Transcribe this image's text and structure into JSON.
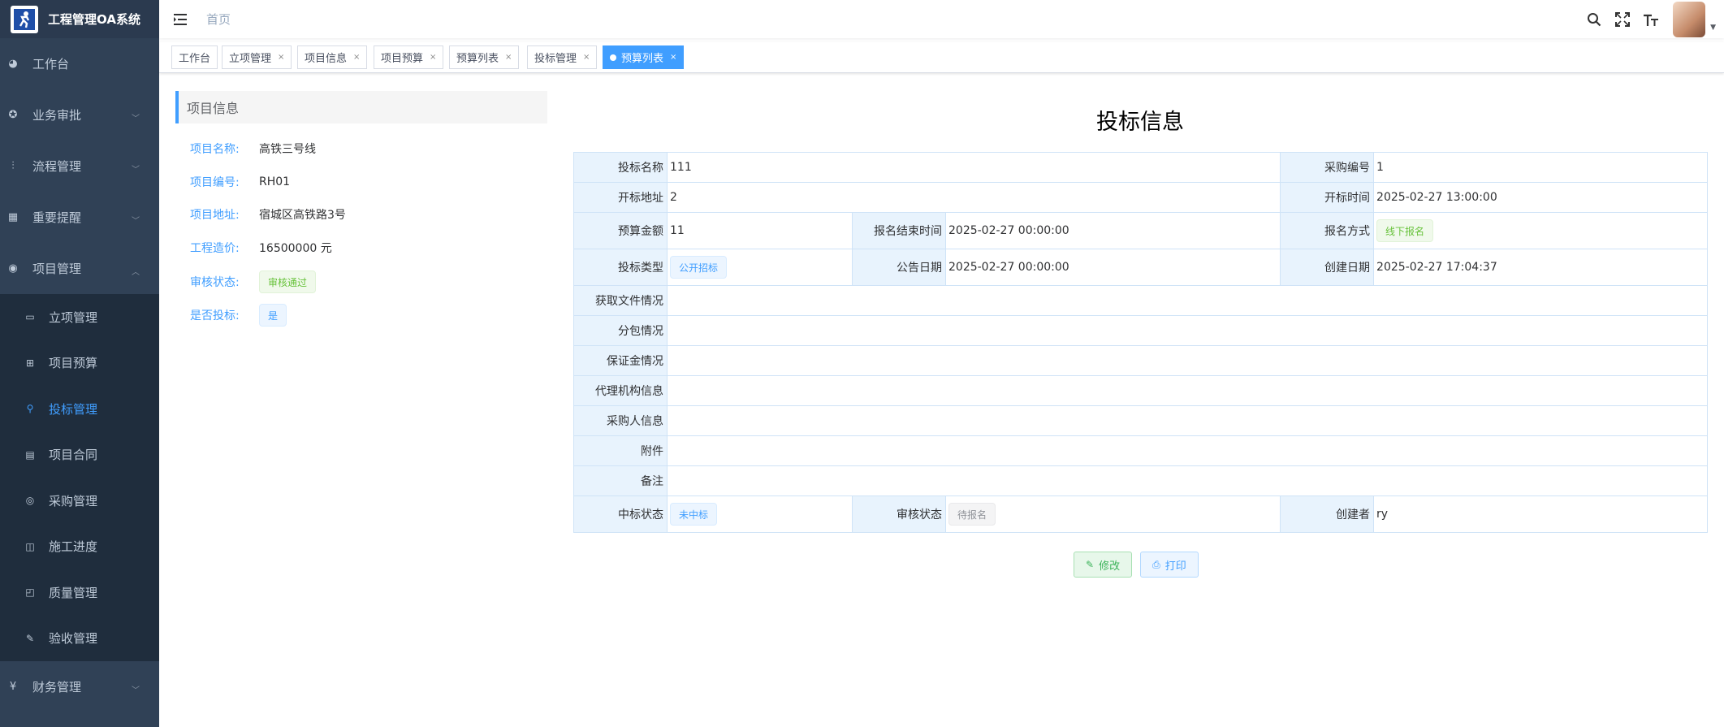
{
  "app": {
    "title": "工程管理OA系统",
    "logo_icon": "runner-logo"
  },
  "sidebar": {
    "items": [
      {
        "label": "工作台",
        "icon": "dashboard-icon"
      },
      {
        "label": "业务审批",
        "icon": "approval-icon"
      },
      {
        "label": "流程管理",
        "icon": "flow-icon"
      },
      {
        "label": "重要提醒",
        "icon": "calendar-icon"
      },
      {
        "label": "项目管理",
        "icon": "globe-icon",
        "expanded": true
      },
      {
        "label": "财务管理",
        "icon": "yen-icon"
      }
    ],
    "project_submenu": [
      {
        "label": "立项管理",
        "icon": "monitor-icon"
      },
      {
        "label": "项目预算",
        "icon": "table-icon"
      },
      {
        "label": "投标管理",
        "icon": "person-icon",
        "active": true
      },
      {
        "label": "项目合同",
        "icon": "document-icon"
      },
      {
        "label": "采购管理",
        "icon": "cart-icon"
      },
      {
        "label": "施工进度",
        "icon": "columns-icon"
      },
      {
        "label": "质量管理",
        "icon": "medal-icon"
      },
      {
        "label": "验收管理",
        "icon": "edit-icon"
      }
    ]
  },
  "header": {
    "breadcrumb": "首页",
    "icons": [
      "search-icon",
      "fullscreen-icon",
      "font-size-icon"
    ]
  },
  "tags": [
    {
      "label": "工作台",
      "closable": false,
      "active": false
    },
    {
      "label": "立项管理",
      "closable": true,
      "active": false
    },
    {
      "label": "项目信息",
      "closable": true,
      "active": false
    },
    {
      "label": "项目预算",
      "closable": true,
      "active": false
    },
    {
      "label": "预算列表",
      "closable": true,
      "active": false
    },
    {
      "label": "投标管理",
      "closable": true,
      "active": false
    },
    {
      "label": "预算列表",
      "closable": true,
      "active": true
    }
  ],
  "close_glyph": "×",
  "project": {
    "heading": "项目信息",
    "fields": [
      {
        "label": "项目名称:",
        "value": "高铁三号线"
      },
      {
        "label": "项目编号:",
        "value": "RH01"
      },
      {
        "label": "项目地址:",
        "value": "宿城区高铁路3号"
      },
      {
        "label": "工程造价:",
        "value": "16500000 元"
      }
    ],
    "audit_label": "审核状态:",
    "audit_value": "审核通过",
    "bid_label": "是否投标:",
    "bid_value": "是"
  },
  "bid": {
    "title": "投标信息",
    "name_label": "投标名称",
    "name": "111",
    "purchase_no_label": "采购编号",
    "purchase_no": "1",
    "open_addr_label": "开标地址",
    "open_addr": "2",
    "open_time_label": "开标时间",
    "open_time": "2025-02-27 13:00:00",
    "budget_label": "预算金额",
    "budget": "11",
    "reg_end_label": "报名结束时间",
    "reg_end": "2025-02-27 00:00:00",
    "reg_method_label": "报名方式",
    "reg_method": "线下报名",
    "type_label": "投标类型",
    "type": "公开招标",
    "notice_date_label": "公告日期",
    "notice_date": "2025-02-27 00:00:00",
    "created_label": "创建日期",
    "created": "2025-02-27 17:04:37",
    "doc_label": "获取文件情况",
    "sub_label": "分包情况",
    "deposit_label": "保证金情况",
    "agency_label": "代理机构信息",
    "buyer_label": "采购人信息",
    "attach_label": "附件",
    "remark_label": "备注",
    "win_status_label": "中标状态",
    "win_status": "未中标",
    "audit_status_label": "审核状态",
    "audit_status": "待报名",
    "creator_label": "创建者",
    "creator": "ry"
  },
  "actions": {
    "edit": "修改",
    "print": "打印"
  },
  "colors": {
    "sidebar_bg": "#304156",
    "submenu_bg": "#1f2d3d",
    "accent": "#409eff",
    "table_label_bg": "#e8f3fd"
  }
}
